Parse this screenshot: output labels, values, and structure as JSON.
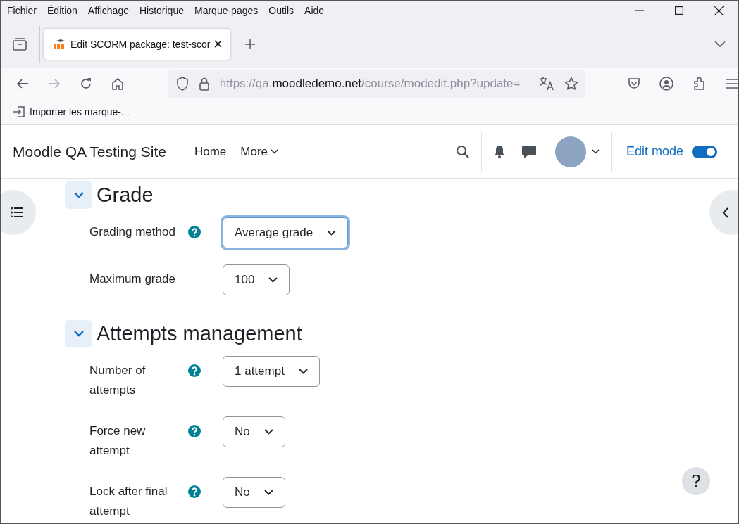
{
  "menu": [
    "Fichier",
    "Édition",
    "Affichage",
    "Historique",
    "Marque-pages",
    "Outils",
    "Aide"
  ],
  "tabs": [
    {
      "title": "Edit SCORM package: test-scor",
      "selected": true
    }
  ],
  "address": {
    "scheme": "https://qa.",
    "domain": "moodledemo.net",
    "path": "/course/modedit.php?update="
  },
  "bookmarks": [
    "Importer les marque-..."
  ],
  "site": {
    "name": "Moodle QA Testing Site",
    "nav": [
      {
        "label": "Home",
        "dropdown": false
      },
      {
        "label": "More",
        "dropdown": true
      }
    ],
    "edit_mode": {
      "label": "Edit mode",
      "on": true
    }
  },
  "sections": [
    {
      "title": "Grade",
      "expanded": true,
      "fields": [
        {
          "label": "Grading method",
          "help": true,
          "value": "Average grade",
          "focused": true
        },
        {
          "label": "Maximum grade",
          "help": false,
          "value": "100",
          "focused": false
        }
      ]
    },
    {
      "title": "Attempts management",
      "expanded": true,
      "fields": [
        {
          "label": "Number of attempts",
          "help": true,
          "value": "1 attempt",
          "focused": false
        },
        {
          "label": "Force new attempt",
          "help": true,
          "value": "No",
          "focused": false
        },
        {
          "label": "Lock after final attempt",
          "help": true,
          "value": "No",
          "focused": false
        }
      ]
    }
  ]
}
